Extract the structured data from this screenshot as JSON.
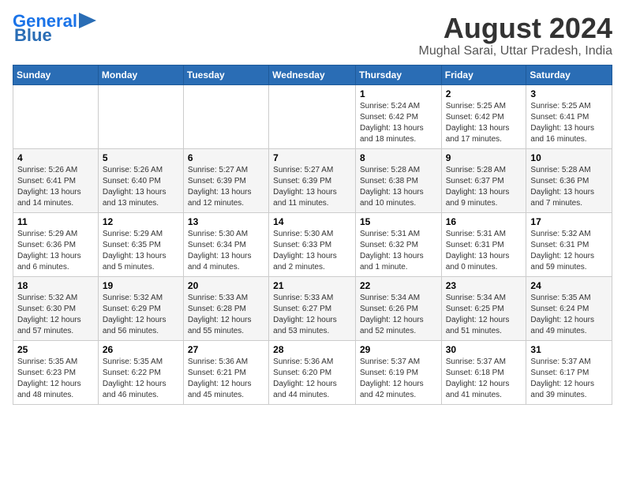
{
  "logo": {
    "line1": "General",
    "line2": "Blue"
  },
  "title": "August 2024",
  "location": "Mughal Sarai, Uttar Pradesh, India",
  "weekdays": [
    "Sunday",
    "Monday",
    "Tuesday",
    "Wednesday",
    "Thursday",
    "Friday",
    "Saturday"
  ],
  "weeks": [
    [
      {
        "day": "",
        "info": ""
      },
      {
        "day": "",
        "info": ""
      },
      {
        "day": "",
        "info": ""
      },
      {
        "day": "",
        "info": ""
      },
      {
        "day": "1",
        "info": "Sunrise: 5:24 AM\nSunset: 6:42 PM\nDaylight: 13 hours\nand 18 minutes."
      },
      {
        "day": "2",
        "info": "Sunrise: 5:25 AM\nSunset: 6:42 PM\nDaylight: 13 hours\nand 17 minutes."
      },
      {
        "day": "3",
        "info": "Sunrise: 5:25 AM\nSunset: 6:41 PM\nDaylight: 13 hours\nand 16 minutes."
      }
    ],
    [
      {
        "day": "4",
        "info": "Sunrise: 5:26 AM\nSunset: 6:41 PM\nDaylight: 13 hours\nand 14 minutes."
      },
      {
        "day": "5",
        "info": "Sunrise: 5:26 AM\nSunset: 6:40 PM\nDaylight: 13 hours\nand 13 minutes."
      },
      {
        "day": "6",
        "info": "Sunrise: 5:27 AM\nSunset: 6:39 PM\nDaylight: 13 hours\nand 12 minutes."
      },
      {
        "day": "7",
        "info": "Sunrise: 5:27 AM\nSunset: 6:39 PM\nDaylight: 13 hours\nand 11 minutes."
      },
      {
        "day": "8",
        "info": "Sunrise: 5:28 AM\nSunset: 6:38 PM\nDaylight: 13 hours\nand 10 minutes."
      },
      {
        "day": "9",
        "info": "Sunrise: 5:28 AM\nSunset: 6:37 PM\nDaylight: 13 hours\nand 9 minutes."
      },
      {
        "day": "10",
        "info": "Sunrise: 5:28 AM\nSunset: 6:36 PM\nDaylight: 13 hours\nand 7 minutes."
      }
    ],
    [
      {
        "day": "11",
        "info": "Sunrise: 5:29 AM\nSunset: 6:36 PM\nDaylight: 13 hours\nand 6 minutes."
      },
      {
        "day": "12",
        "info": "Sunrise: 5:29 AM\nSunset: 6:35 PM\nDaylight: 13 hours\nand 5 minutes."
      },
      {
        "day": "13",
        "info": "Sunrise: 5:30 AM\nSunset: 6:34 PM\nDaylight: 13 hours\nand 4 minutes."
      },
      {
        "day": "14",
        "info": "Sunrise: 5:30 AM\nSunset: 6:33 PM\nDaylight: 13 hours\nand 2 minutes."
      },
      {
        "day": "15",
        "info": "Sunrise: 5:31 AM\nSunset: 6:32 PM\nDaylight: 13 hours\nand 1 minute."
      },
      {
        "day": "16",
        "info": "Sunrise: 5:31 AM\nSunset: 6:31 PM\nDaylight: 13 hours\nand 0 minutes."
      },
      {
        "day": "17",
        "info": "Sunrise: 5:32 AM\nSunset: 6:31 PM\nDaylight: 12 hours\nand 59 minutes."
      }
    ],
    [
      {
        "day": "18",
        "info": "Sunrise: 5:32 AM\nSunset: 6:30 PM\nDaylight: 12 hours\nand 57 minutes."
      },
      {
        "day": "19",
        "info": "Sunrise: 5:32 AM\nSunset: 6:29 PM\nDaylight: 12 hours\nand 56 minutes."
      },
      {
        "day": "20",
        "info": "Sunrise: 5:33 AM\nSunset: 6:28 PM\nDaylight: 12 hours\nand 55 minutes."
      },
      {
        "day": "21",
        "info": "Sunrise: 5:33 AM\nSunset: 6:27 PM\nDaylight: 12 hours\nand 53 minutes."
      },
      {
        "day": "22",
        "info": "Sunrise: 5:34 AM\nSunset: 6:26 PM\nDaylight: 12 hours\nand 52 minutes."
      },
      {
        "day": "23",
        "info": "Sunrise: 5:34 AM\nSunset: 6:25 PM\nDaylight: 12 hours\nand 51 minutes."
      },
      {
        "day": "24",
        "info": "Sunrise: 5:35 AM\nSunset: 6:24 PM\nDaylight: 12 hours\nand 49 minutes."
      }
    ],
    [
      {
        "day": "25",
        "info": "Sunrise: 5:35 AM\nSunset: 6:23 PM\nDaylight: 12 hours\nand 48 minutes."
      },
      {
        "day": "26",
        "info": "Sunrise: 5:35 AM\nSunset: 6:22 PM\nDaylight: 12 hours\nand 46 minutes."
      },
      {
        "day": "27",
        "info": "Sunrise: 5:36 AM\nSunset: 6:21 PM\nDaylight: 12 hours\nand 45 minutes."
      },
      {
        "day": "28",
        "info": "Sunrise: 5:36 AM\nSunset: 6:20 PM\nDaylight: 12 hours\nand 44 minutes."
      },
      {
        "day": "29",
        "info": "Sunrise: 5:37 AM\nSunset: 6:19 PM\nDaylight: 12 hours\nand 42 minutes."
      },
      {
        "day": "30",
        "info": "Sunrise: 5:37 AM\nSunset: 6:18 PM\nDaylight: 12 hours\nand 41 minutes."
      },
      {
        "day": "31",
        "info": "Sunrise: 5:37 AM\nSunset: 6:17 PM\nDaylight: 12 hours\nand 39 minutes."
      }
    ]
  ]
}
